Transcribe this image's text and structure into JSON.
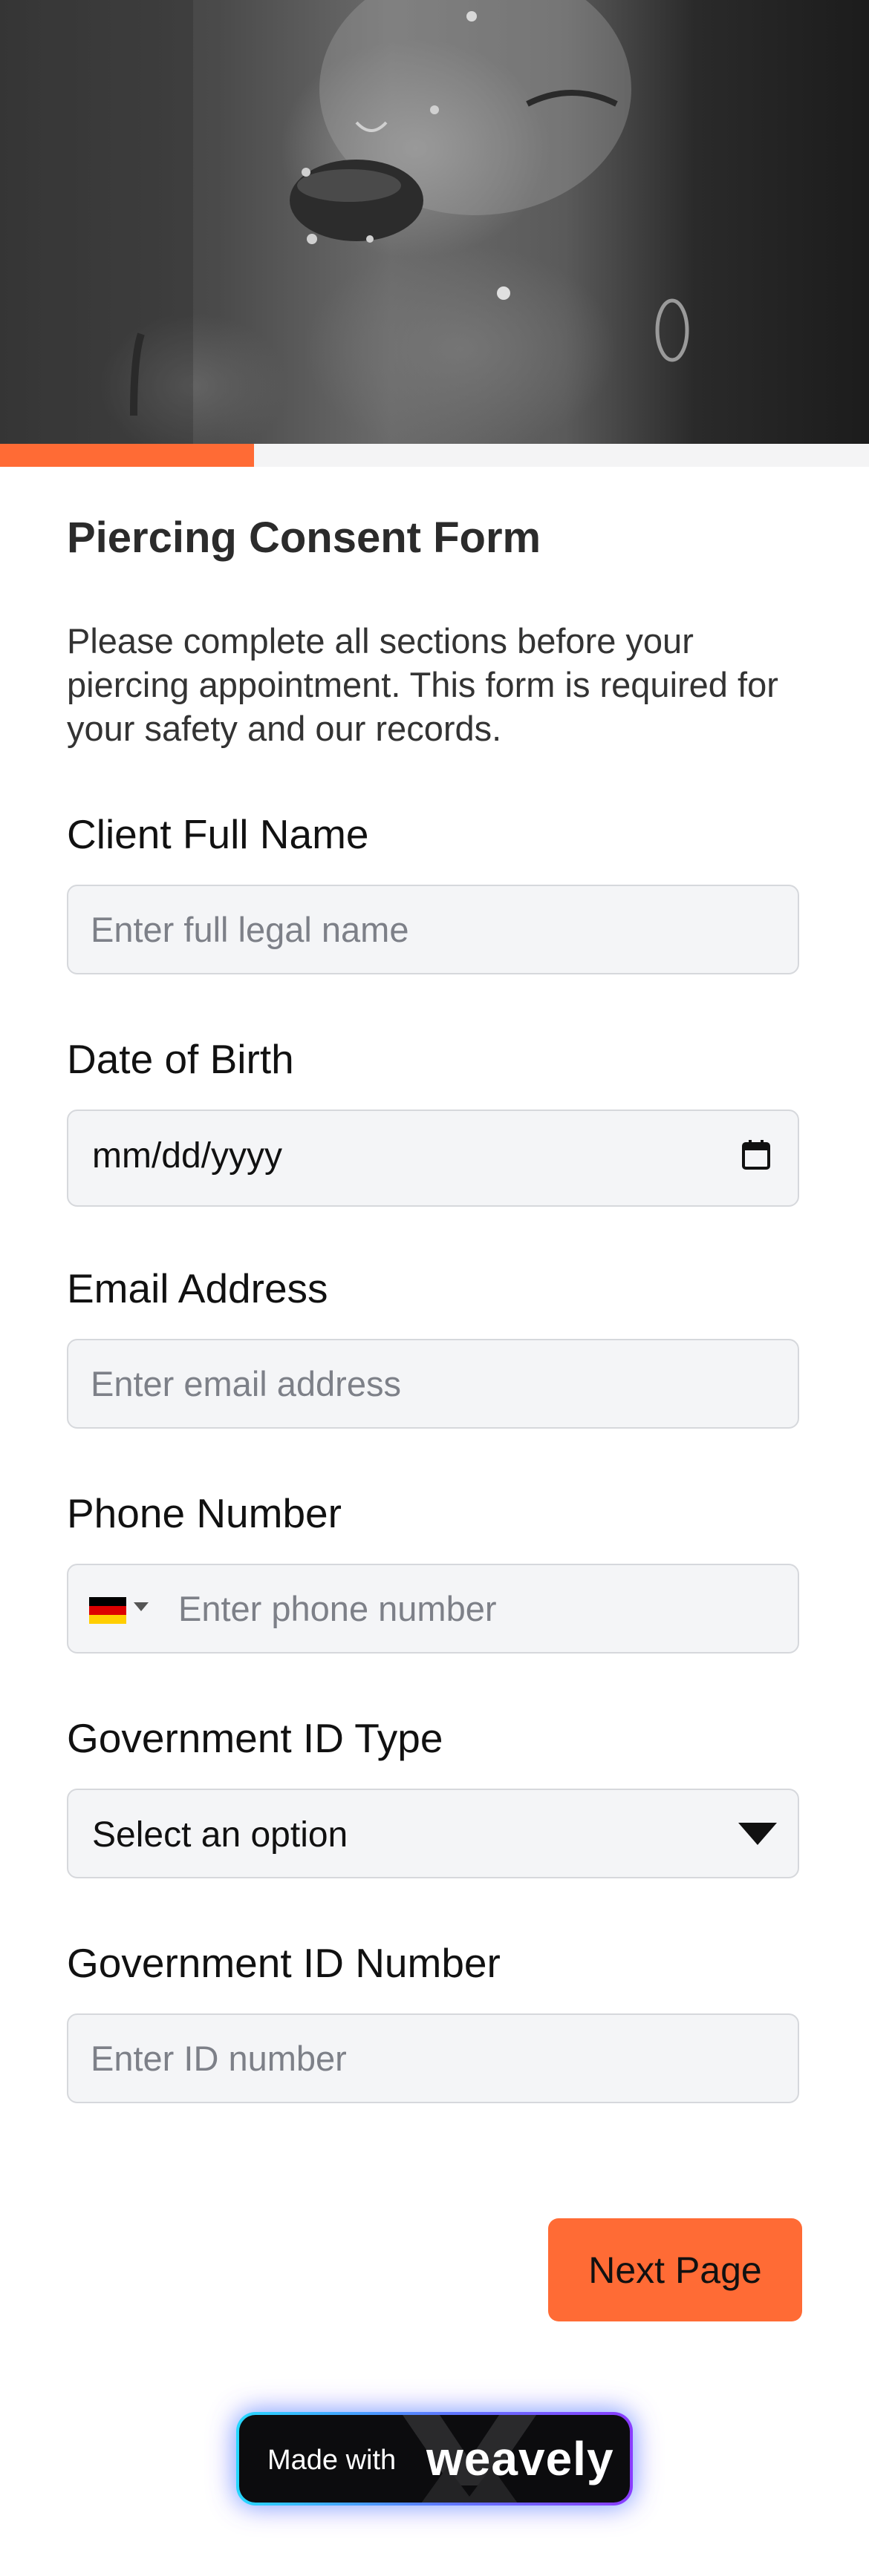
{
  "progress": {
    "fraction": 0.25,
    "color": "#ff6b35"
  },
  "form": {
    "title": "Piercing Consent Form",
    "description": "Please complete all sections before your piercing appointment. This form is required for your safety and our records."
  },
  "fields": {
    "full_name": {
      "label": "Client Full Name",
      "placeholder": "Enter full legal name"
    },
    "dob": {
      "label": "Date of Birth",
      "value": "mm/dd/yyyy",
      "icon": "calendar-icon"
    },
    "email": {
      "label": "Email Address",
      "placeholder": "Enter email address"
    },
    "phone": {
      "label": "Phone Number",
      "placeholder": "Enter phone number",
      "country_flag": "germany-flag-icon"
    },
    "id_type": {
      "label": "Government ID Type",
      "selected": "Select an option"
    },
    "id_number": {
      "label": "Government ID Number",
      "placeholder": "Enter ID number"
    }
  },
  "buttons": {
    "next": "Next Page"
  },
  "badge": {
    "made_with": "Made with",
    "brand": "weavely"
  }
}
